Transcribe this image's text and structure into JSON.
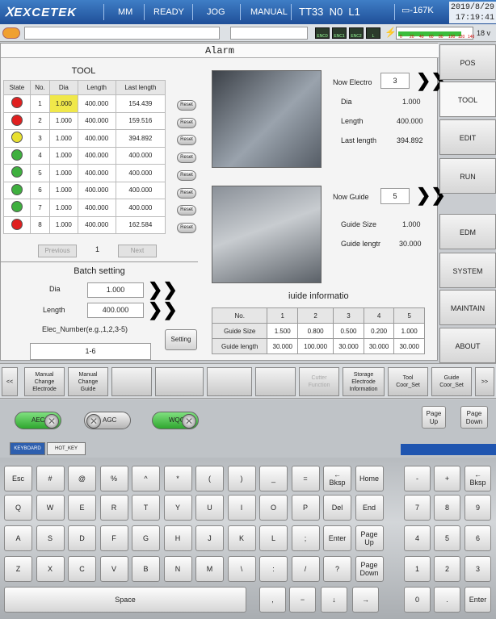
{
  "header": {
    "brand": "EXCETEK",
    "items": [
      "MM",
      "READY",
      "JOG",
      "MANUAL",
      "TT33  N0  L1"
    ],
    "battery": "-167K",
    "date": "2019/8/29",
    "time": "17:19:41"
  },
  "status": {
    "leds": [
      "ENC0",
      "ENC1",
      "ENC2",
      "L"
    ],
    "gauge_labels": [
      "0",
      "20",
      "40",
      "60",
      "80",
      "100",
      "120",
      "140"
    ],
    "gauge_level_fraction": 0.85,
    "voltage": "18 v"
  },
  "alarm": {
    "title": "Alarm"
  },
  "tool": {
    "title": "TOOL",
    "headers": [
      "State",
      "No.",
      "Dia",
      "Length",
      "Last length"
    ],
    "rows": [
      {
        "state_color": "#e02020",
        "no": "1",
        "dia": "1.000",
        "length": "400.000",
        "last": "154.439"
      },
      {
        "state_color": "#e02020",
        "no": "2",
        "dia": "1.000",
        "length": "400.000",
        "last": "159.516"
      },
      {
        "state_color": "#e8e030",
        "no": "3",
        "dia": "1.000",
        "length": "400.000",
        "last": "394.892"
      },
      {
        "state_color": "#3fb03f",
        "no": "4",
        "dia": "1.000",
        "length": "400.000",
        "last": "400.000"
      },
      {
        "state_color": "#3fb03f",
        "no": "5",
        "dia": "1.000",
        "length": "400.000",
        "last": "400.000"
      },
      {
        "state_color": "#3fb03f",
        "no": "6",
        "dia": "1.000",
        "length": "400.000",
        "last": "400.000"
      },
      {
        "state_color": "#3fb03f",
        "no": "7",
        "dia": "1.000",
        "length": "400.000",
        "last": "400.000"
      },
      {
        "state_color": "#e02020",
        "no": "8",
        "dia": "1.000",
        "length": "400.000",
        "last": "162.584"
      }
    ],
    "reset_label": "Reset",
    "previous": "Previous",
    "page": "1",
    "next": "Next"
  },
  "batch": {
    "title": "Batch setting",
    "dia_label": "Dia",
    "dia_value": "1.000",
    "length_label": "Length",
    "length_value": "400.000",
    "elec_label": "Elec_Number(e.g.,1,2,3-5)",
    "setting": "Setting",
    "elec_value": "1-6"
  },
  "electrode": {
    "now_label": "Now Electro",
    "now_value": "3",
    "dia_label": "Dia",
    "dia_value": "1.000",
    "length_label": "Length",
    "length_value": "400.000",
    "last_label": "Last length",
    "last_value": "394.892"
  },
  "guide": {
    "now_label": "Now Guide",
    "now_value": "5",
    "size_label": "Guide Size",
    "size_value": "1.000",
    "length_label": "Guide lengtr",
    "length_value": "30.000",
    "info_title": "iuide informatio",
    "table_headers": [
      "No.",
      "1",
      "2",
      "3",
      "4",
      "5"
    ],
    "size_row": [
      "Guide Size",
      "1.500",
      "0.800",
      "0.500",
      "0.200",
      "1.000"
    ],
    "length_row": [
      "Guide length",
      "30.000",
      "100.000",
      "30.000",
      "30.000",
      "30.000"
    ]
  },
  "nav": [
    "POS",
    "TOOL",
    "EDIT",
    "RUN",
    "EDM",
    "SYSTEM",
    "MAINTAIN",
    "ABOUT"
  ],
  "func": {
    "left_arrow": "<<",
    "right_arrow": ">>",
    "manual_electrode": [
      "Manual",
      "Change",
      "Electrode"
    ],
    "manual_guide": [
      "Manual",
      "Change",
      "Guide"
    ],
    "cutter": [
      "Cutter",
      "Function"
    ],
    "storage": [
      "Storage",
      "Electrode",
      "Information"
    ],
    "tool_coor": [
      "Tool",
      "Coor_Set"
    ],
    "guide_coor": [
      "Guide",
      "Coor_Set"
    ]
  },
  "toggles": {
    "aec": "AEC",
    "agc": "AGC",
    "wqc": "WQC",
    "page_up": [
      "Page",
      "Up"
    ],
    "page_down": [
      "Page",
      "Down"
    ]
  },
  "tabs": {
    "keyboard": "KEYBOARD",
    "hot_key": "HOT_KEY"
  },
  "keys": {
    "row1": [
      "Esc",
      "#",
      "@",
      "%",
      "^",
      "*",
      "(",
      ")",
      "_",
      "=",
      [
        "←",
        "Bksp"
      ],
      "Home"
    ],
    "row2": [
      "Q",
      "W",
      "E",
      "R",
      "T",
      "Y",
      "U",
      "I",
      "O",
      "P",
      "Del",
      "End"
    ],
    "row3": [
      "A",
      "S",
      "D",
      "F",
      "G",
      "H",
      "J",
      "K",
      "L",
      ";",
      "Enter",
      [
        "Page",
        "Up"
      ]
    ],
    "row4": [
      "Z",
      "X",
      "C",
      "V",
      "B",
      "N",
      "M",
      "\\",
      ":",
      "/",
      "?",
      [
        "Page",
        "Down"
      ]
    ],
    "row5": [
      "Space",
      ",",
      "−",
      "↓",
      "→"
    ],
    "pad": [
      "-",
      "+",
      [
        "←",
        "Bksp"
      ],
      "7",
      "8",
      "9",
      "4",
      "5",
      "6",
      "1",
      "2",
      "3",
      "0",
      ".",
      "Enter"
    ]
  }
}
